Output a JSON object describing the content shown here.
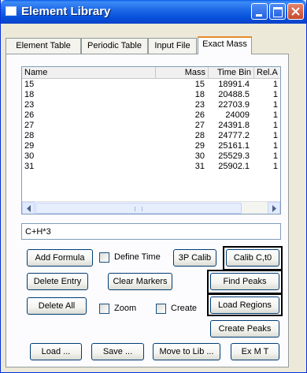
{
  "window": {
    "title": "Element Library"
  },
  "tabs": [
    "Element Table",
    "Periodic Table",
    "Input File",
    "Exact Mass"
  ],
  "table": {
    "columns": [
      "Name",
      "Mass",
      "Time Bin",
      "Rel.A"
    ],
    "rows": [
      [
        "15",
        "15",
        "18991.4",
        "1"
      ],
      [
        "18",
        "18",
        "20488.5",
        "1"
      ],
      [
        "23",
        "23",
        "22703.9",
        "1"
      ],
      [
        "26",
        "26",
        "24009",
        "1"
      ],
      [
        "27",
        "27",
        "24391.8",
        "1"
      ],
      [
        "28",
        "28",
        "24777.2",
        "1"
      ],
      [
        "29",
        "29",
        "25161.1",
        "1"
      ],
      [
        "30",
        "30",
        "25529.3",
        "1"
      ],
      [
        "31",
        "31",
        "25902.1",
        "1"
      ]
    ]
  },
  "formula": {
    "value": "C+H*3"
  },
  "buttons": {
    "add_formula": "Add Formula",
    "define_time": "Define Time",
    "calib_3p": "3P Calib",
    "calib_ct0": "Calib C,t0",
    "delete_entry": "Delete Entry",
    "clear_markers": "Clear Markers",
    "find_peaks": "Find Peaks",
    "delete_all": "Delete All",
    "zoom": "Zoom",
    "create": "Create",
    "load_regions": "Load Regions",
    "create_peaks": "Create Peaks",
    "load": "Load ...",
    "save": "Save ...",
    "move_to_lib": "Move to Lib ...",
    "exmt": "Ex M T"
  },
  "colors": {
    "titlebar": "#0a5bea",
    "active_tab_accent": "#e68b2c",
    "button_border": "#003c74"
  }
}
